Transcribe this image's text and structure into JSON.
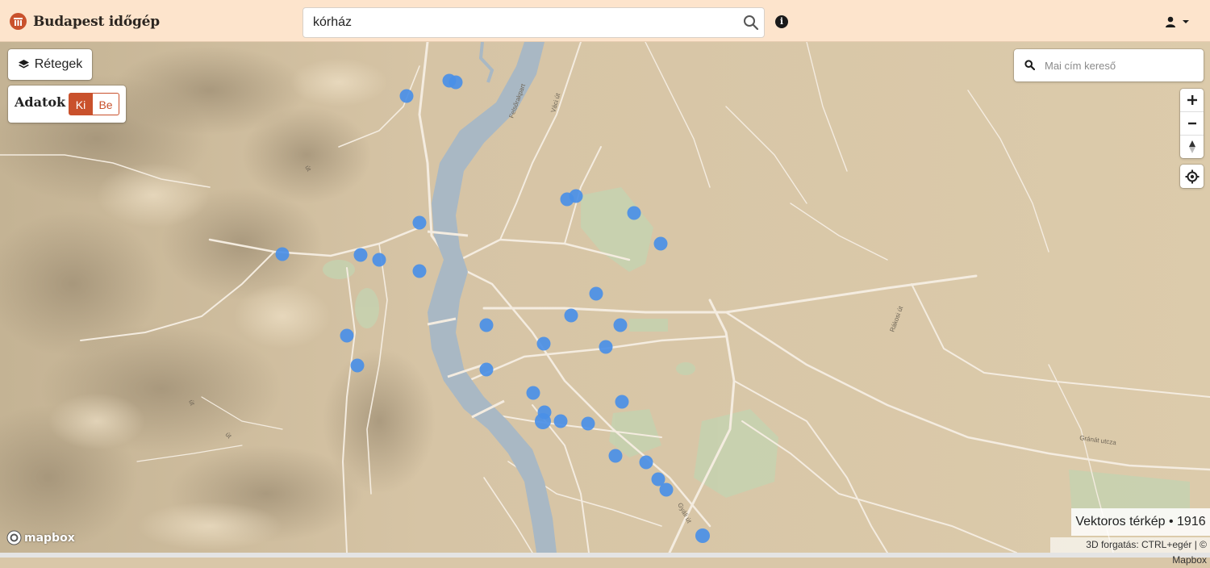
{
  "header": {
    "title": "Budapest időgép",
    "search_value": "kórház",
    "info_label": "i",
    "brand_color": "#c9512c",
    "background": "#fde4cc"
  },
  "controls": {
    "layers_label": "Rétegek",
    "data_label": "Adatok",
    "toggle_off": "Ki",
    "toggle_on": "Be",
    "toggle_selected": "Ki",
    "address_placeholder": "Mai cím kereső"
  },
  "map": {
    "marker_color": "#4a8fe7",
    "map_info": "Vektoros térkép • 1916",
    "attribution": "3D forgatás: CTRL+egér | © Mapbox",
    "logo_text": "mapbox",
    "street_labels": [
      "Felsőrakpart",
      "Váci út",
      "út",
      "út",
      "út",
      "Rákosi út",
      "Gránát utcza",
      "Gyáli út"
    ]
  }
}
